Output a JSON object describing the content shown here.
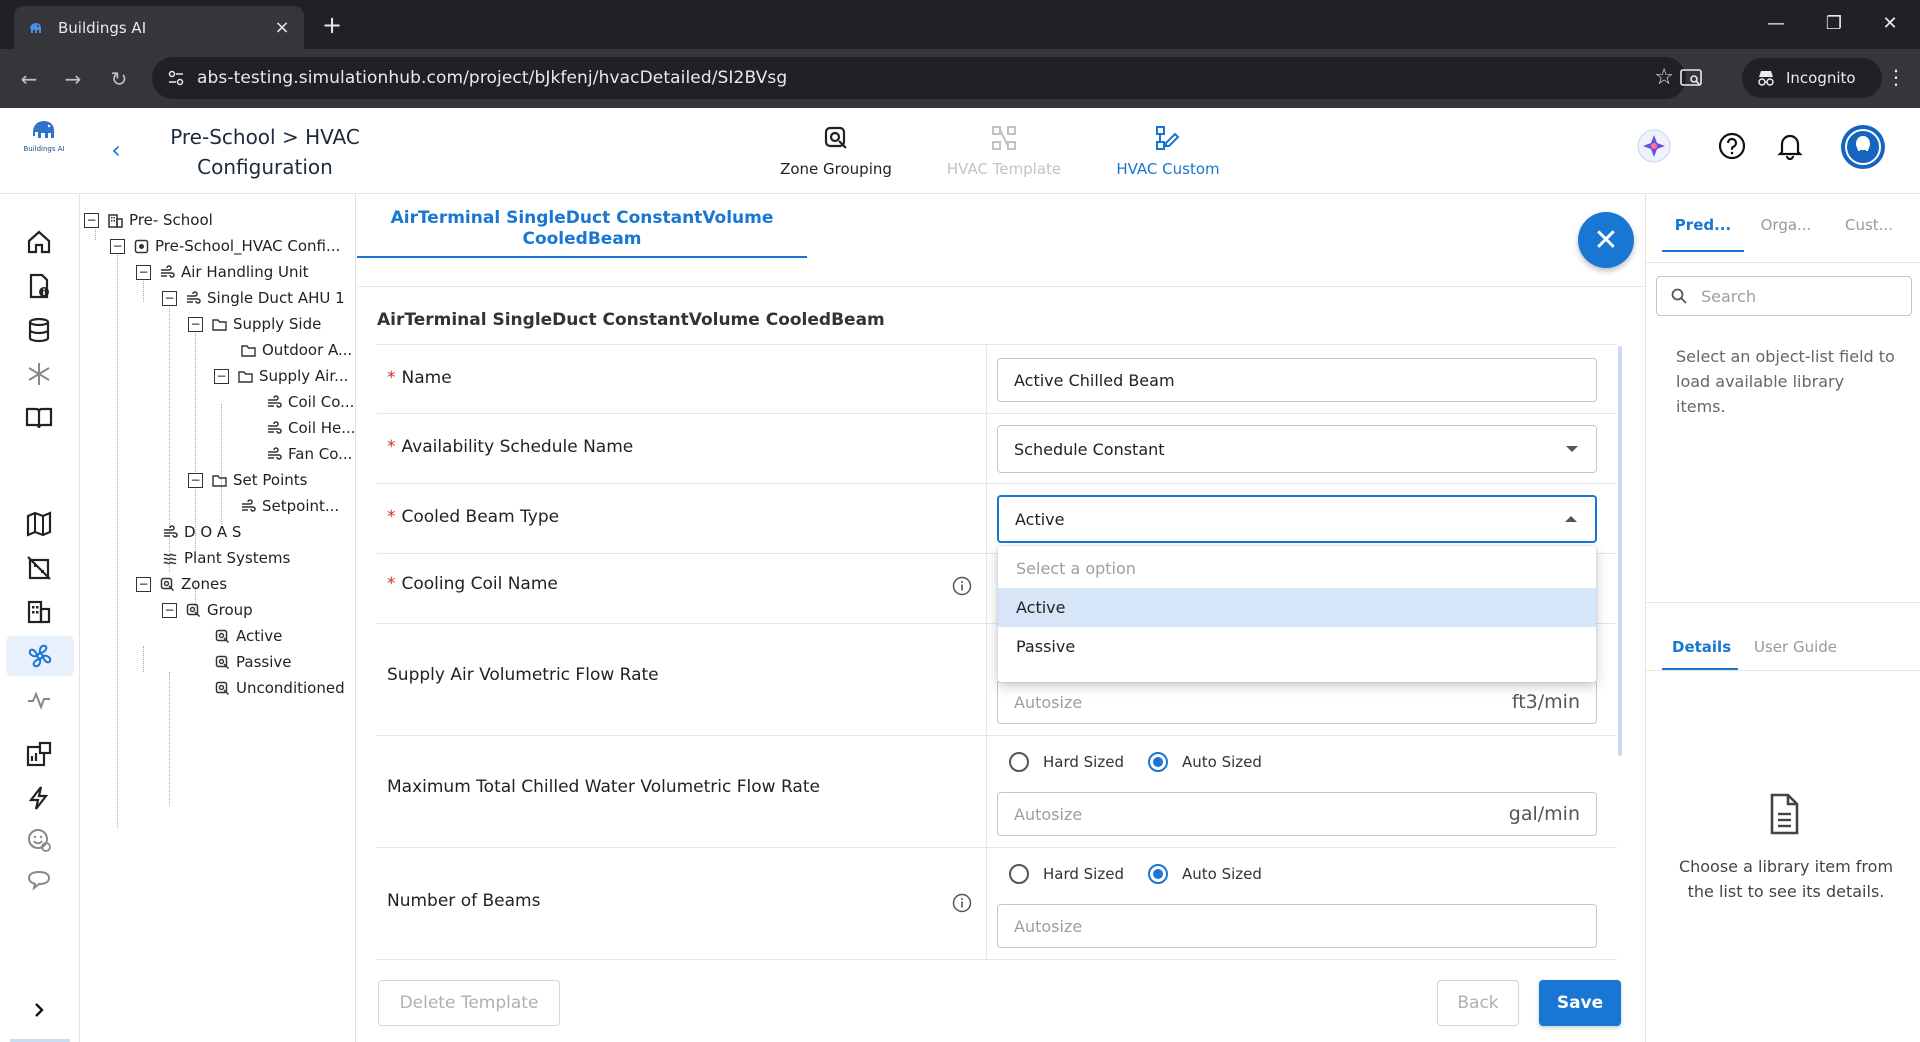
{
  "browser": {
    "tab_title": "Buildings AI",
    "tab_close": "×",
    "new_tab": "+",
    "url": "abs-testing.simulationhub.com/project/bJkfenj/hvacDetailed/SI2BVsg",
    "incognito_label": "Incognito",
    "min": "—",
    "max": "❐",
    "close": "✕",
    "back": "←",
    "forward": "→",
    "reload": "↻",
    "star": "☆",
    "kebab": "⋮"
  },
  "header": {
    "logo_text": "Buildings AI",
    "project_title_line1": "Pre-School > HVAC",
    "project_title_line2": "Configuration",
    "tabs": [
      {
        "label": "Zone Grouping",
        "state": "normal"
      },
      {
        "label": "HVAC Template",
        "state": "disabled"
      },
      {
        "label": "HVAC Custom",
        "state": "active"
      }
    ],
    "accent_color": "#1976d2"
  },
  "tree": {
    "nodes": [
      {
        "label": "Pre- School"
      },
      {
        "label": "Pre-School_HVAC Confi..."
      },
      {
        "label": "Air Handling Unit"
      },
      {
        "label": "Single Duct AHU 1"
      },
      {
        "label": "Supply Side"
      },
      {
        "label": "Outdoor A..."
      },
      {
        "label": "Supply Air..."
      },
      {
        "label": "Coil Co..."
      },
      {
        "label": "Coil He..."
      },
      {
        "label": "Fan Co..."
      },
      {
        "label": "Set Points"
      },
      {
        "label": "Setpoint..."
      },
      {
        "label": "D O A S"
      },
      {
        "label": "Plant Systems"
      },
      {
        "label": "Zones"
      },
      {
        "label": "Group"
      },
      {
        "label": "Active"
      },
      {
        "label": "Passive"
      },
      {
        "label": "Unconditioned"
      }
    ]
  },
  "form": {
    "tab_label_line1": "AirTerminal SingleDuct ConstantVolume",
    "tab_label_line2": "CooledBeam",
    "section_title": "AirTerminal SingleDuct ConstantVolume CooledBeam",
    "close_glyph": "✕",
    "required_mark": "*",
    "fields": {
      "name": {
        "label": "Name",
        "value": "Active Chilled Beam"
      },
      "availability": {
        "label": "Availability Schedule Name",
        "value": "Schedule Constant"
      },
      "beam_type": {
        "label": "Cooled Beam Type",
        "value": "Active"
      },
      "cooling_coil": {
        "label": "Cooling Coil Name"
      },
      "supply_air": {
        "label": "Supply Air Volumetric Flow Rate",
        "placeholder": "Autosize",
        "unit": "ft3/min"
      },
      "chilled_water": {
        "label": "Maximum Total Chilled Water Volumetric Flow Rate",
        "placeholder": "Autosize",
        "unit": "gal/min",
        "hard_sized": "Hard Sized",
        "auto_sized": "Auto Sized"
      },
      "num_beams": {
        "label": "Number of Beams",
        "placeholder": "Autosize",
        "hard_sized": "Hard Sized",
        "auto_sized": "Auto Sized"
      }
    },
    "dropdown": {
      "placeholder": "Select a option",
      "options": [
        "Active",
        "Passive"
      ],
      "selected": "Active"
    },
    "buttons": {
      "delete": "Delete Template",
      "back": "Back",
      "save": "Save"
    }
  },
  "right_panel": {
    "tabs": [
      "Pred...",
      "Orga...",
      "Cust..."
    ],
    "search_placeholder": "Search",
    "hint": "Select an object-list field to load available library items.",
    "detail_tabs": [
      "Details",
      "User Guide"
    ],
    "choose_text": "Choose a library item from the list to see its details."
  }
}
